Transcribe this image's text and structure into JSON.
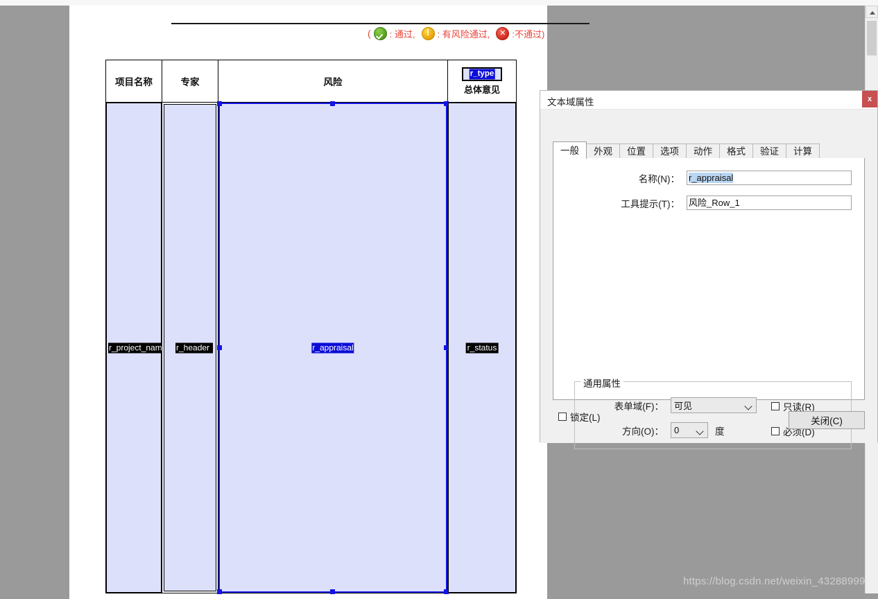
{
  "viewer": {
    "watermark": "https://blog.csdn.net/weixin_43288999",
    "scrollbar": {
      "up_arrow": "scroll-up-arrow"
    }
  },
  "document": {
    "legend": {
      "open_paren": "(",
      "pass_label": ": 通过,",
      "risk_label": ": 有风险通过,",
      "fail_label": ":不通过)"
    },
    "table": {
      "headers": [
        "项目名称",
        "专家",
        "风险",
        "总体意见"
      ],
      "header_field": {
        "name": "r_type"
      },
      "row_fields": [
        {
          "name": "r_project_name",
          "selected": false
        },
        {
          "name": "r_header",
          "selected": false
        },
        {
          "name": "r_appraisal",
          "selected": true
        },
        {
          "name": "r_status",
          "selected": false
        }
      ]
    }
  },
  "dialog": {
    "title": "文本域属性",
    "close_x": "x",
    "tabs": [
      {
        "label": "一般",
        "active": true
      },
      {
        "label": "外观",
        "active": false
      },
      {
        "label": "位置",
        "active": false
      },
      {
        "label": "选项",
        "active": false
      },
      {
        "label": "动作",
        "active": false
      },
      {
        "label": "格式",
        "active": false
      },
      {
        "label": "验证",
        "active": false
      },
      {
        "label": "计算",
        "active": false
      }
    ],
    "general": {
      "name_label": "名称(N)：",
      "name_value": "r_appraisal",
      "tooltip_label": "工具提示(T)：",
      "tooltip_value": "风险_Row_1"
    },
    "common_properties": {
      "legend": "通用属性",
      "form_field_label": "表单域(F)：",
      "form_field_value": "可见",
      "orientation_label": "方向(O)：",
      "orientation_value": "0",
      "orientation_unit": "度",
      "readonly_label": "只读(R)",
      "readonly_checked": false,
      "required_label": "必须(D)",
      "required_checked": false
    },
    "footer": {
      "lock_label": "锁定(L)",
      "lock_checked": false,
      "close_button": "关闭(C)"
    }
  },
  "colors": {
    "field_fill": "#dce0fa",
    "selection_blue": "#1414e6",
    "dialog_close_red": "#c75050",
    "accent_red_text": "#e8443a"
  }
}
